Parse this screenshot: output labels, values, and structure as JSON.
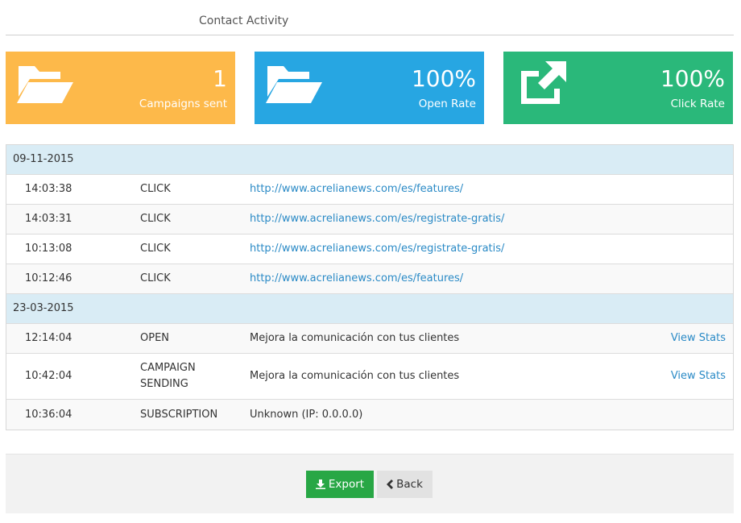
{
  "header": {
    "title": "Contact Activity"
  },
  "cards": [
    {
      "value": "1",
      "label": "Campaigns sent",
      "color": "#fdb94a",
      "icon": "folder-open-icon"
    },
    {
      "value": "100%",
      "label": "Open Rate",
      "color": "#27a6e2",
      "icon": "folder-open-icon"
    },
    {
      "value": "100%",
      "label": "Click Rate",
      "color": "#2ab87a",
      "icon": "external-link-icon"
    }
  ],
  "groups": [
    {
      "date": "09-11-2015",
      "rows": [
        {
          "time": "14:03:38",
          "type": "CLICK",
          "detail": "http://www.acrelianews.com/es/features/",
          "action": ""
        },
        {
          "time": "14:03:31",
          "type": "CLICK",
          "detail": "http://www.acrelianews.com/es/registrate-gratis/",
          "action": ""
        },
        {
          "time": "10:13:08",
          "type": "CLICK",
          "detail": "http://www.acrelianews.com/es/registrate-gratis/",
          "action": ""
        },
        {
          "time": "10:12:46",
          "type": "CLICK",
          "detail": "http://www.acrelianews.com/es/features/",
          "action": ""
        }
      ]
    },
    {
      "date": "23-03-2015",
      "rows": [
        {
          "time": "12:14:04",
          "type": "OPEN",
          "detail": "Mejora la comunicación con tus clientes",
          "action": "View Stats"
        },
        {
          "time": "10:42:04",
          "type_line1": "CAMPAIGN",
          "type_line2": "SENDING",
          "detail": "Mejora la comunicación con tus clientes",
          "action": "View Stats"
        },
        {
          "time": "10:36:04",
          "type": "SUBSCRIPTION",
          "detail": "Unknown (IP: 0.0.0.0)",
          "action": ""
        }
      ]
    }
  ],
  "footer": {
    "export_label": "Export",
    "back_label": "Back"
  }
}
